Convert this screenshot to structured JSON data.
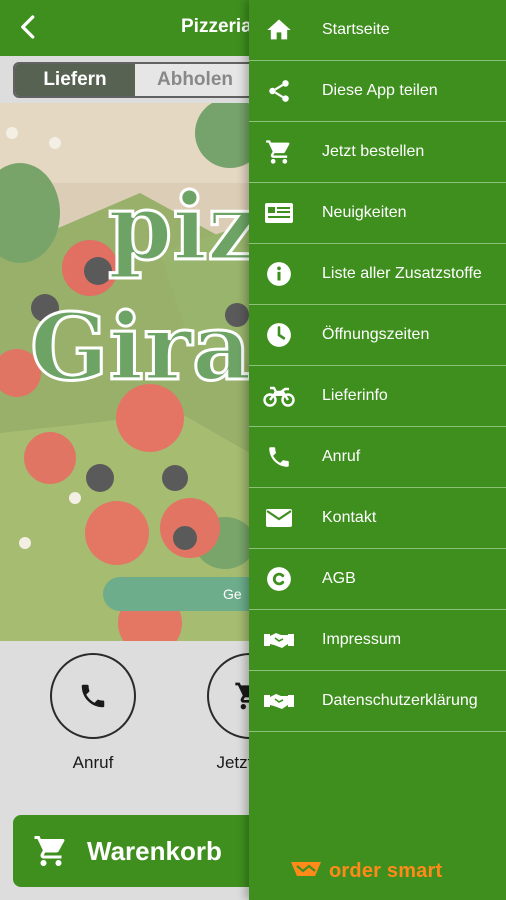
{
  "appbar": {
    "title": "Pizzeria"
  },
  "order_mode": {
    "delivery_label": "Liefern",
    "pickup_label": "Abholen",
    "selected": "Liefern"
  },
  "hero": {
    "logo_line1": "piz",
    "logo_line2": "Gira",
    "pill_text": "Ge"
  },
  "actions": [
    {
      "label": "Anruf",
      "icon": "phone-icon"
    },
    {
      "label": "Jetzt b",
      "icon": "cart-icon"
    }
  ],
  "cart": {
    "label": "Warenkorb",
    "icon": "cart-icon"
  },
  "drawer": {
    "items": [
      {
        "label": "Startseite",
        "icon": "home-icon"
      },
      {
        "label": "Diese App teilen",
        "icon": "share-icon"
      },
      {
        "label": "Jetzt bestellen",
        "icon": "cart-icon"
      },
      {
        "label": "Neuigkeiten",
        "icon": "news-icon"
      },
      {
        "label": "Liste aller Zusatzstoffe",
        "icon": "info-icon"
      },
      {
        "label": "Öffnungszeiten",
        "icon": "clock-icon"
      },
      {
        "label": "Lieferinfo",
        "icon": "motorcycle-icon"
      },
      {
        "label": "Anruf",
        "icon": "phone-icon"
      },
      {
        "label": "Kontakt",
        "icon": "mail-icon"
      },
      {
        "label": "AGB",
        "icon": "copyright-icon"
      },
      {
        "label": "Impressum",
        "icon": "handshake-icon"
      },
      {
        "label": "Datenschutzerklärung",
        "icon": "handshake-icon"
      }
    ],
    "brand": "order smart"
  },
  "colors": {
    "primary_green": "#3f8f1f",
    "divider": "#8dc07a",
    "brand_orange": "#ff8a1a"
  }
}
